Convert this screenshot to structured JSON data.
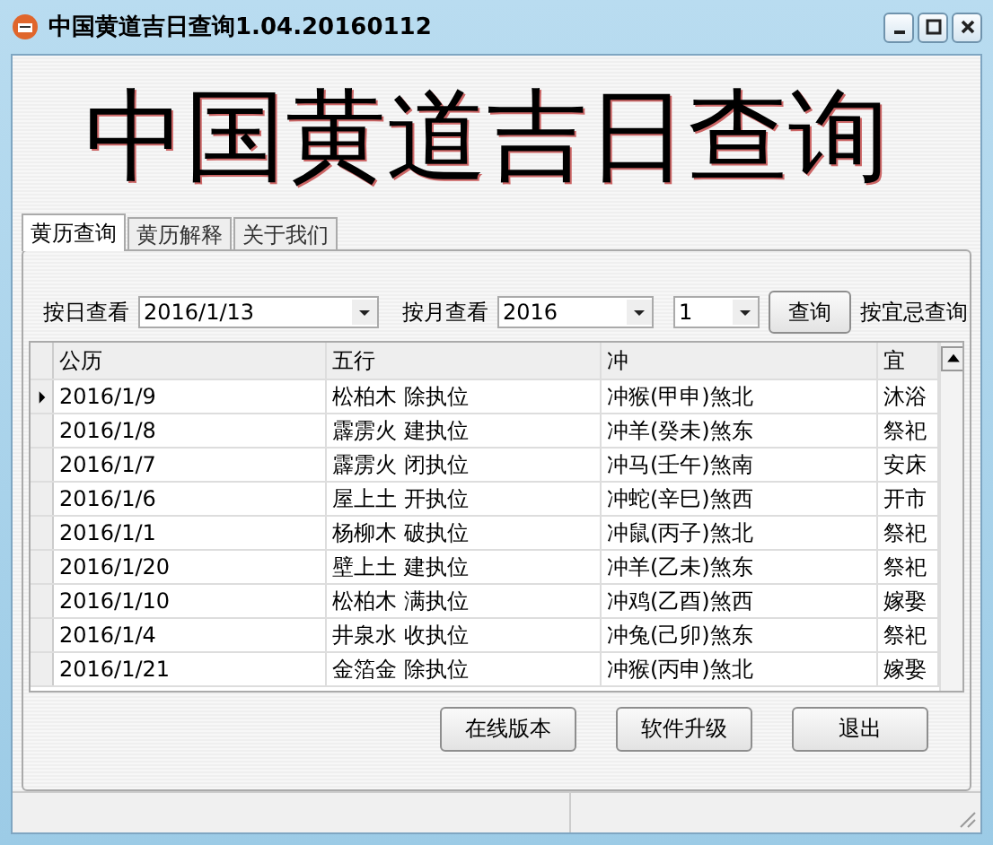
{
  "window": {
    "title": "中国黄道吉日查询1.04.20160112"
  },
  "banner": "中国黄道吉日查询",
  "tabs": [
    {
      "label": "黄历查询",
      "selected": true
    },
    {
      "label": "黄历解释",
      "selected": false
    },
    {
      "label": "关于我们",
      "selected": false
    }
  ],
  "search": {
    "day_label": "按日查看",
    "day_value": "2016/1/13",
    "month_label": "按月查看",
    "year_value": "2016",
    "month_value": "1",
    "query_button": "查询",
    "yiji_label": "按宜忌查询"
  },
  "table": {
    "columns": [
      "公历",
      "五行",
      "冲",
      "宜"
    ],
    "rows": [
      {
        "selected": true,
        "cells": [
          "2016/1/9",
          "松柏木  除执位",
          "冲猴(甲申)煞北",
          "沐浴"
        ]
      },
      {
        "selected": false,
        "cells": [
          "2016/1/8",
          "霹雳火  建执位",
          "冲羊(癸未)煞东",
          "祭祀"
        ]
      },
      {
        "selected": false,
        "cells": [
          "2016/1/7",
          "霹雳火  闭执位",
          "冲马(壬午)煞南",
          "安床"
        ]
      },
      {
        "selected": false,
        "cells": [
          "2016/1/6",
          "屋上土  开执位",
          "冲蛇(辛巳)煞西",
          "开市"
        ]
      },
      {
        "selected": false,
        "cells": [
          "2016/1/1",
          "杨柳木  破执位",
          "冲鼠(丙子)煞北",
          "祭祀"
        ]
      },
      {
        "selected": false,
        "cells": [
          "2016/1/20",
          "壁上土  建执位",
          "冲羊(乙未)煞东",
          "祭祀"
        ]
      },
      {
        "selected": false,
        "cells": [
          "2016/1/10",
          "松柏木  满执位",
          "冲鸡(乙酉)煞西",
          "嫁娶"
        ]
      },
      {
        "selected": false,
        "cells": [
          "2016/1/4",
          "井泉水  收执位",
          "冲兔(己卯)煞东",
          "祭祀"
        ]
      },
      {
        "selected": false,
        "cells": [
          "2016/1/21",
          "金箔金  除执位",
          "冲猴(丙申)煞北",
          "嫁娶"
        ]
      }
    ]
  },
  "buttons": [
    "在线版本",
    "软件升级",
    "退出"
  ]
}
